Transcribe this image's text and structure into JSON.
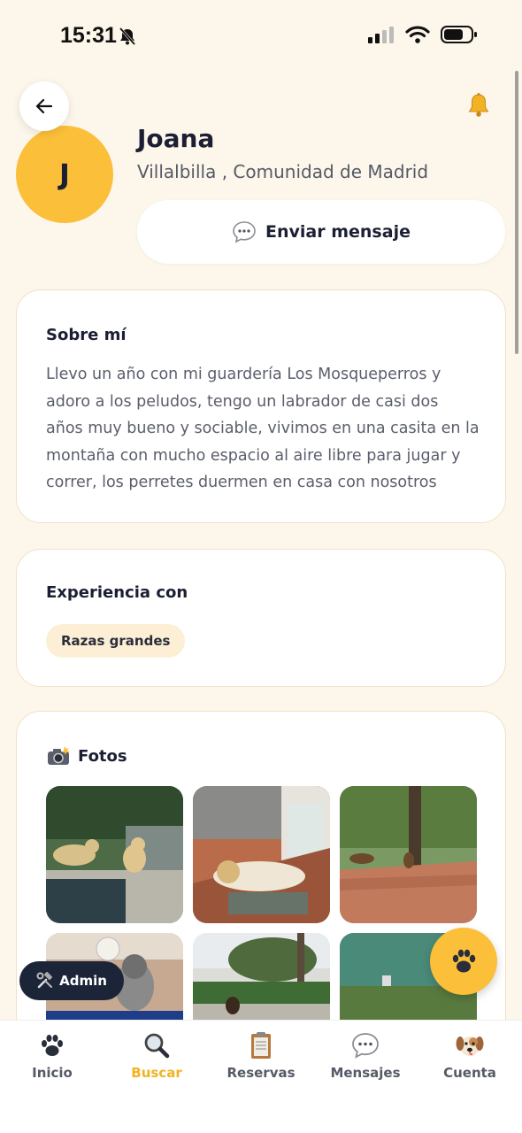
{
  "status_bar": {
    "time": "15:31"
  },
  "profile": {
    "initial": "J",
    "name": "Joana",
    "location": "Villalbilla , Comunidad de Madrid",
    "message_button": "Enviar mensaje"
  },
  "about": {
    "title": "Sobre mí",
    "text": "Llevo un año con mi guardería Los Mosqueperros y adoro a los peludos, tengo un labrador de casi dos años muy bueno y sociable, vivimos en una casita en la montaña con mucho espacio al aire libre para jugar y correr, los perretes duermen en casa con nosotros"
  },
  "experience": {
    "title": "Experiencia con",
    "tags": [
      "Razas grandes"
    ]
  },
  "photos": {
    "title": "Fotos",
    "count": 6
  },
  "admin_button": "Admin",
  "nav": {
    "items": [
      {
        "label": "Inicio",
        "icon": "paw-icon"
      },
      {
        "label": "Buscar",
        "icon": "magnifier-icon"
      },
      {
        "label": "Reservas",
        "icon": "clipboard-icon"
      },
      {
        "label": "Mensajes",
        "icon": "speech-bubble-icon"
      },
      {
        "label": "Cuenta",
        "icon": "dog-face-icon"
      }
    ],
    "active_index": 1
  },
  "colors": {
    "accent": "#fbbf3a",
    "active_nav": "#f1b322",
    "background": "#fdf6ea"
  }
}
